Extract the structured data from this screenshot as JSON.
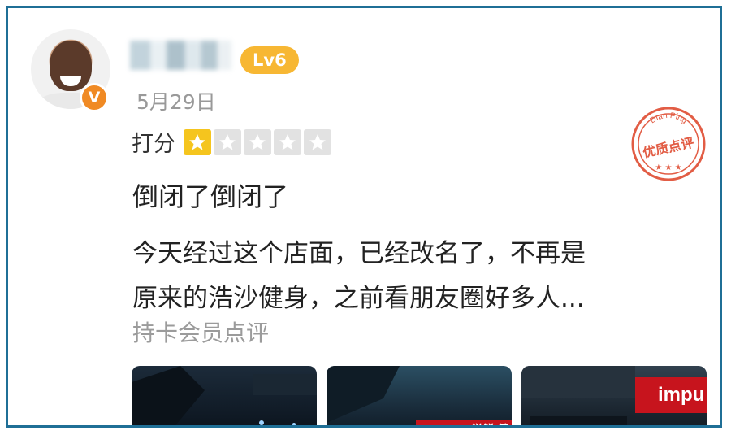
{
  "user": {
    "level_badge": "Lv6",
    "vip_badge": "V",
    "date": "5月29日"
  },
  "rating": {
    "label": "打分",
    "stars_filled": 1,
    "stars_total": 5
  },
  "review": {
    "title": "倒闭了倒闭了",
    "body_line1": "今天经过这个店面，已经改名了，不再是",
    "body_line2": "原来的浩沙健身，之前看朋友圈好多人...",
    "member_note": "持卡会员点评"
  },
  "stamp": {
    "arc_text": "Dian Ping",
    "label": "优质点评"
  },
  "photos": [
    {
      "sign": ""
    },
    {
      "sign": "impulse 溢锐 健身"
    },
    {
      "sign": "impu"
    }
  ],
  "colors": {
    "frame": "#1f6f96",
    "level": "#f7b733",
    "star_filled": "#f5c51e",
    "star_empty": "#e2e2e2",
    "stamp": "#e25d45"
  }
}
